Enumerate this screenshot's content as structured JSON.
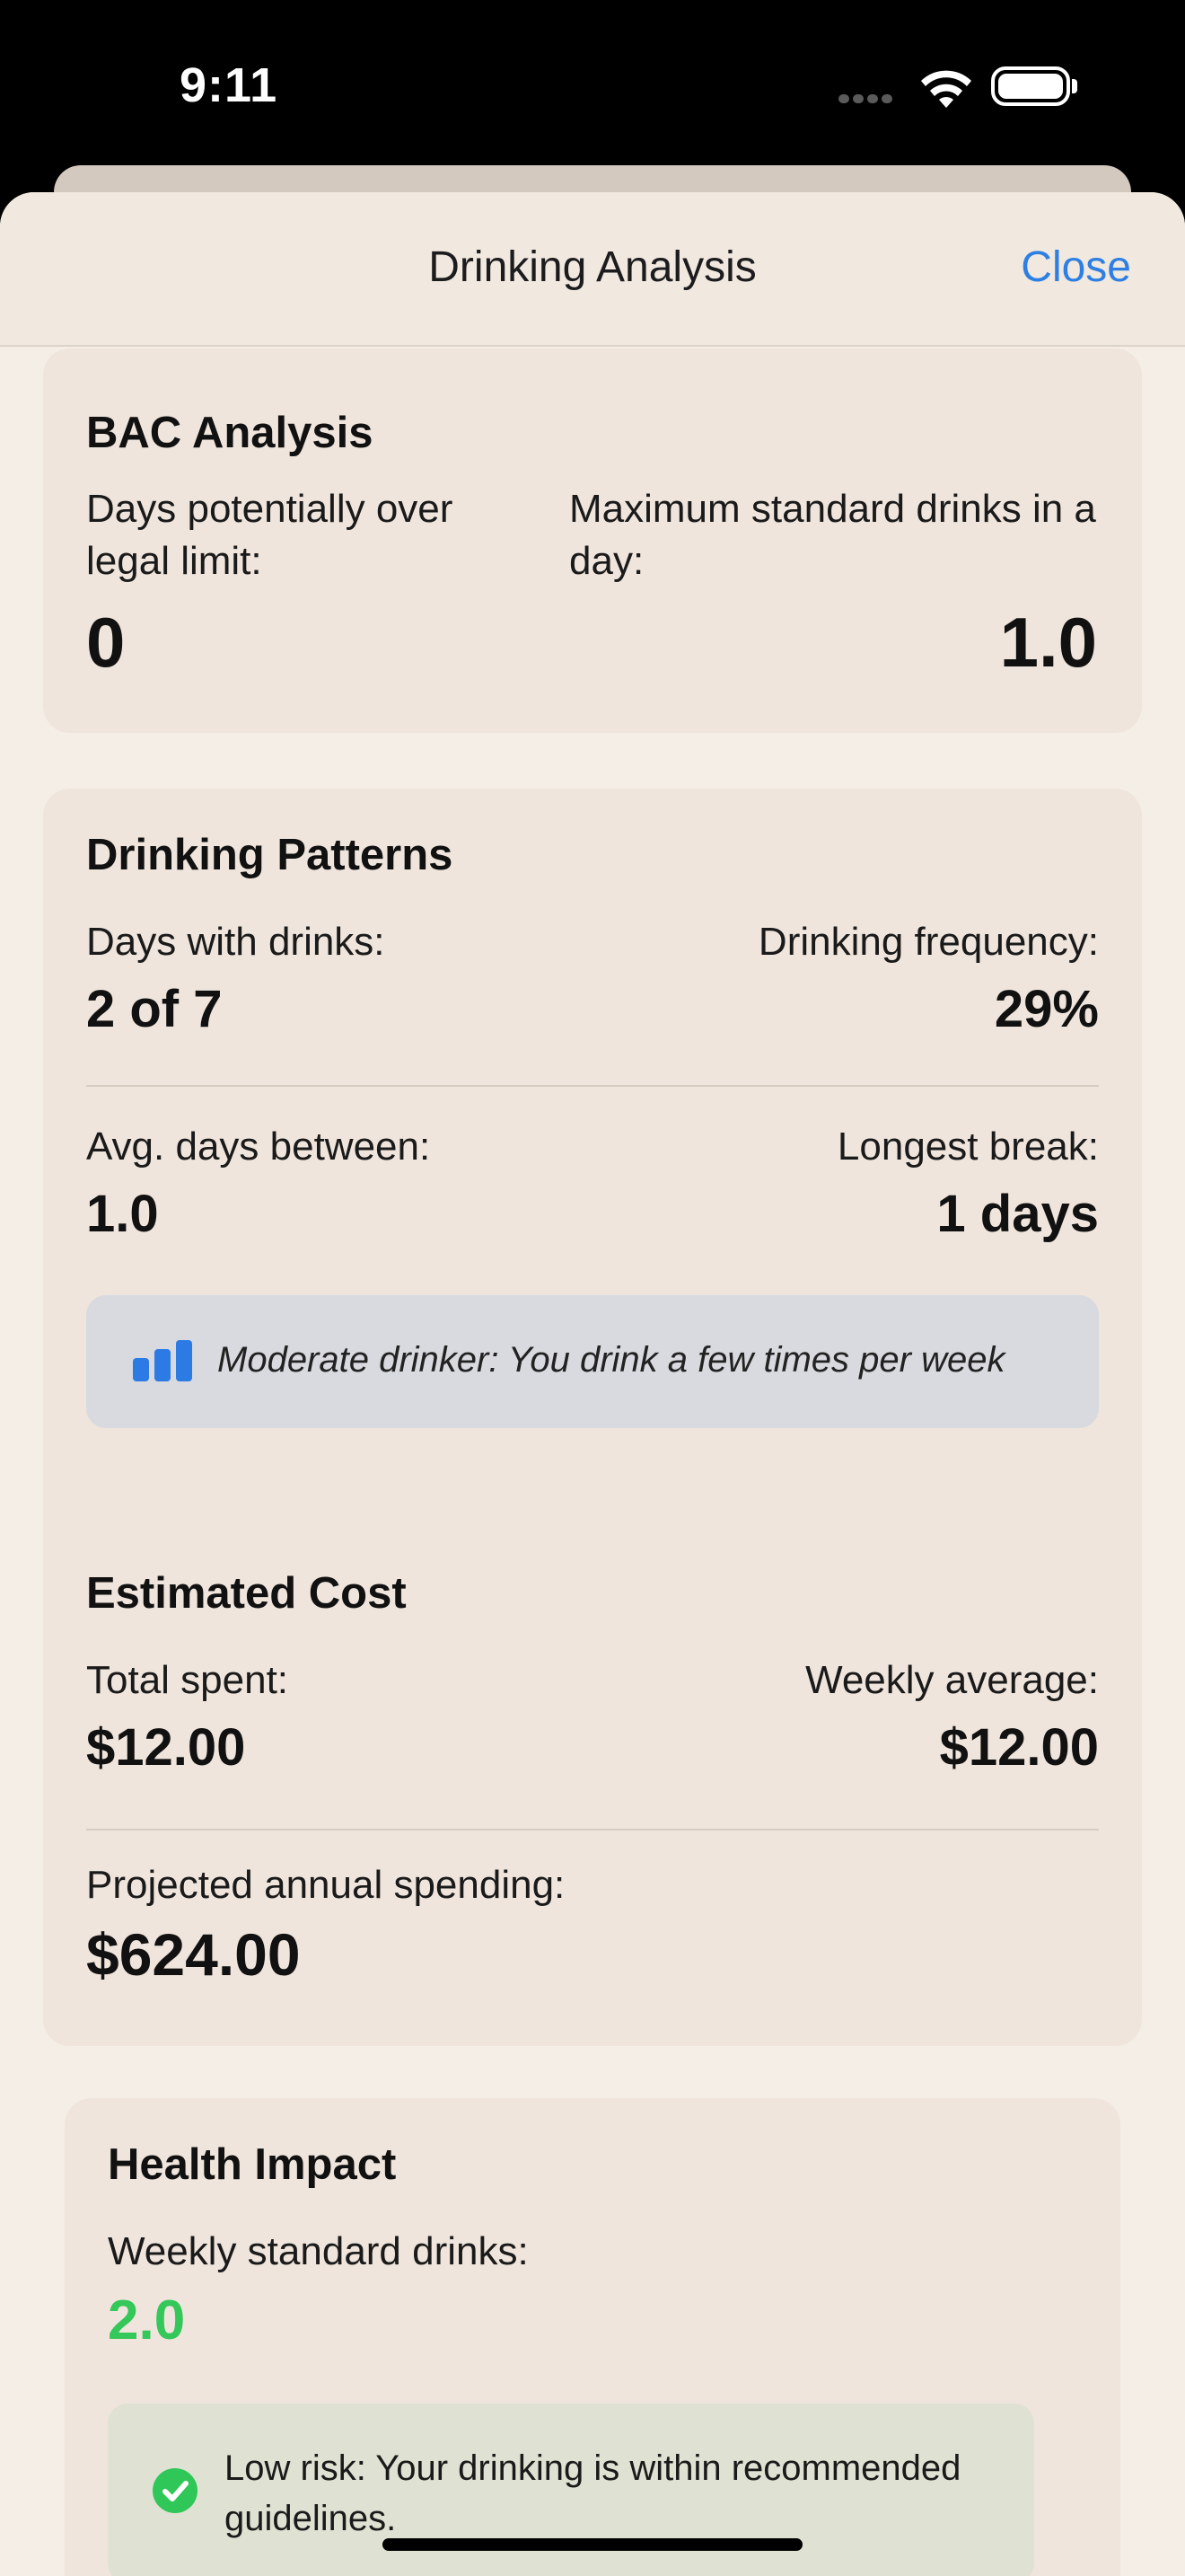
{
  "status_bar": {
    "time": "9:11"
  },
  "nav": {
    "title": "Drinking Analysis",
    "close_label": "Close"
  },
  "bac": {
    "title": "BAC Analysis",
    "days_over_label": "Days potentially over legal limit:",
    "days_over_value": "0",
    "max_drinks_label": "Maximum standard drinks in a day:",
    "max_drinks_value": "1.0"
  },
  "patterns": {
    "title": "Drinking Patterns",
    "days_with_label": "Days with drinks:",
    "days_with_value": "2 of 7",
    "frequency_label": "Drinking frequency:",
    "frequency_value": "29%",
    "avg_between_label": "Avg. days between:",
    "avg_between_value": "1.0",
    "longest_break_label": "Longest break:",
    "longest_break_value": "1 days",
    "insight_text": "Moderate drinker: You drink a few times per week",
    "insight_icon": "bar-chart-icon"
  },
  "cost": {
    "title": "Estimated Cost",
    "total_label": "Total spent:",
    "total_value": "$12.00",
    "weekly_label": "Weekly average:",
    "weekly_value": "$12.00",
    "annual_label": "Projected annual spending:",
    "annual_value": "$624.00"
  },
  "health": {
    "title": "Health Impact",
    "weekly_label": "Weekly standard drinks:",
    "weekly_value": "2.0",
    "status_text": "Low risk: Your drinking is within recommended guidelines.",
    "status_icon": "checkmark-circle-icon",
    "value_color": "#34c759"
  },
  "colors": {
    "accent": "#2d7fe3",
    "card": "#efe5dc",
    "success": "#30c759"
  }
}
